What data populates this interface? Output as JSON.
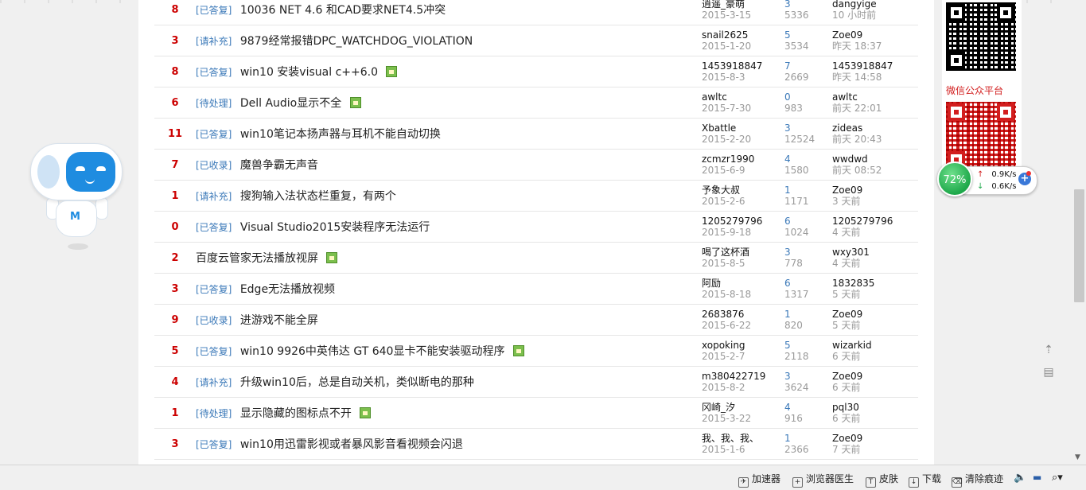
{
  "topics": [
    {
      "num": "8",
      "tag": "[已答复]",
      "title": "10036 NET 4.6 和CAD要求NET4.5冲突",
      "image": false,
      "author": "逍遥_豪萌",
      "created": "2015-3-15",
      "replies": "3",
      "views": "5336",
      "last_user": "dangyige",
      "last_time": "10 小时前"
    },
    {
      "num": "3",
      "tag": "[请补充]",
      "title": "9879经常报错DPC_WATCHDOG_VIOLATION",
      "image": false,
      "author": "snail2625",
      "created": "2015-1-20",
      "replies": "5",
      "views": "3534",
      "last_user": "Zoe09",
      "last_time": "昨天 18:37"
    },
    {
      "num": "8",
      "tag": "[已答复]",
      "title": "win10 安装visual c++6.0",
      "image": true,
      "author": "1453918847",
      "created": "2015-8-3",
      "replies": "7",
      "views": "2669",
      "last_user": "1453918847",
      "last_time": "昨天 14:58"
    },
    {
      "num": "6",
      "tag": "[待处理]",
      "title": "Dell Audio显示不全",
      "image": true,
      "author": "awltc",
      "created": "2015-7-30",
      "replies": "0",
      "views": "983",
      "last_user": "awltc",
      "last_time": "前天 22:01"
    },
    {
      "num": "11",
      "tag": "[已答复]",
      "title": "win10笔记本扬声器与耳机不能自动切换",
      "image": false,
      "author": "Xbattle",
      "created": "2015-2-20",
      "replies": "3",
      "views": "12524",
      "last_user": "zideas",
      "last_time": "前天 20:43"
    },
    {
      "num": "7",
      "tag": "[已收录]",
      "title": "魔兽争霸无声音",
      "image": false,
      "author": "zcmzr1990",
      "created": "2015-6-9",
      "replies": "4",
      "views": "1580",
      "last_user": "wwdwd",
      "last_time": "前天 08:52"
    },
    {
      "num": "1",
      "tag": "[请补充]",
      "title": "搜狗输入法状态栏重复，有两个",
      "image": false,
      "author": "予象大叔",
      "created": "2015-2-6",
      "replies": "1",
      "views": "1171",
      "last_user": "Zoe09",
      "last_time": "3 天前"
    },
    {
      "num": "0",
      "tag": "[已答复]",
      "title": "Visual Studio2015安装程序无法运行",
      "image": false,
      "author": "1205279796",
      "created": "2015-9-18",
      "replies": "6",
      "views": "1024",
      "last_user": "1205279796",
      "last_time": "4 天前"
    },
    {
      "num": "2",
      "tag": "",
      "title": "百度云管家无法播放视屏",
      "image": true,
      "author": "喝了这杯酒",
      "created": "2015-8-5",
      "replies": "3",
      "views": "778",
      "last_user": "wxy301",
      "last_time": "4 天前"
    },
    {
      "num": "3",
      "tag": "[已答复]",
      "title": "Edge无法播放视频",
      "image": false,
      "author": "阿励",
      "created": "2015-8-18",
      "replies": "6",
      "views": "1317",
      "last_user": "1832835",
      "last_time": "5 天前"
    },
    {
      "num": "9",
      "tag": "[已收录]",
      "title": "进游戏不能全屏",
      "image": false,
      "author": "2683876",
      "created": "2015-6-22",
      "replies": "1",
      "views": "820",
      "last_user": "Zoe09",
      "last_time": "5 天前"
    },
    {
      "num": "5",
      "tag": "[已答复]",
      "title": "win10 9926中英伟达 GT 640显卡不能安装驱动程序",
      "image": true,
      "author": "xopoking",
      "created": "2015-2-7",
      "replies": "5",
      "views": "2118",
      "last_user": "wizarkid",
      "last_time": "6 天前"
    },
    {
      "num": "4",
      "tag": "[请补充]",
      "title": "升级win10后，总是自动关机，类似断电的那种",
      "image": false,
      "author": "m380422719",
      "created": "2015-8-2",
      "replies": "3",
      "views": "3624",
      "last_user": "Zoe09",
      "last_time": "6 天前"
    },
    {
      "num": "1",
      "tag": "[待处理]",
      "title": "显示隐藏的图标点不开",
      "image": true,
      "author": "冈崎_汐",
      "created": "2015-3-22",
      "replies": "4",
      "views": "916",
      "last_user": "pql30",
      "last_time": "6 天前"
    },
    {
      "num": "3",
      "tag": "[已答复]",
      "title": "win10用迅雷影视或者暴风影音看视频会闪退",
      "image": false,
      "author": "我、我、我、",
      "created": "2015-1-6",
      "replies": "1",
      "views": "2366",
      "last_user": "Zoe09",
      "last_time": "7 天前"
    }
  ],
  "sidebar": {
    "wechat_label": "微信公众平台"
  },
  "speed": {
    "percent": "72%",
    "upload": "0.9K/s",
    "download": "0.6K/s"
  },
  "statusbar": {
    "accelerator": "加速器",
    "doctor": "浏览器医生",
    "skin": "皮肤",
    "download": "下载",
    "clear": "清除痕迹"
  },
  "mascot": {
    "logo": "M"
  }
}
